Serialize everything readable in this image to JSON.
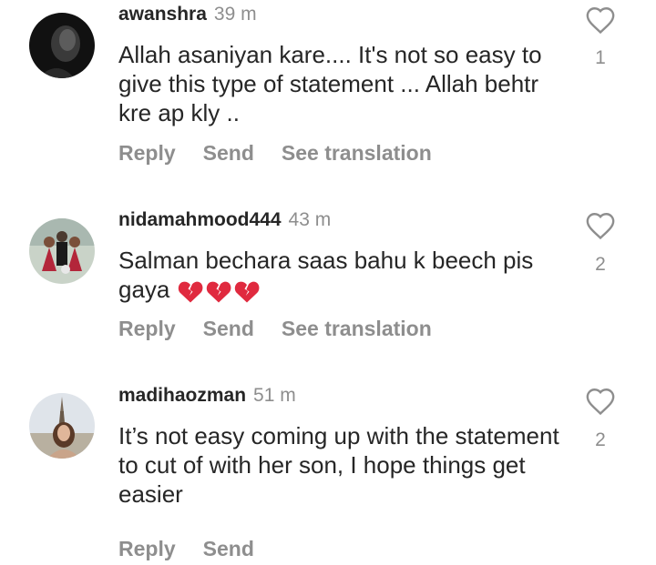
{
  "comments": [
    {
      "username": "awanshra",
      "time": "39 m",
      "text": "Allah asaniyan kare.... It's not so easy to give this type of statement ... Allah behtr kre ap kly ..",
      "likes": "1",
      "actions": {
        "reply": "Reply",
        "send": "Send",
        "translate": "See translation"
      }
    },
    {
      "username": "nidamahmood444",
      "time": "43 m",
      "text": "Salman bechara saas bahu k beech pis gaya",
      "emoji": [
        "broken-heart",
        "broken-heart",
        "broken-heart"
      ],
      "likes": "2",
      "actions": {
        "reply": "Reply",
        "send": "Send",
        "translate": "See translation"
      }
    },
    {
      "username": "madihaozman",
      "time": "51 m",
      "text": "It’s not easy coming up with the statement to cut of with her son, I hope things get easier",
      "likes": "2",
      "actions": {
        "reply": "Reply",
        "send": "Send"
      }
    }
  ],
  "colors": {
    "primary_text": "#262626",
    "secondary_text": "#8e8e8e",
    "emoji_red": "#e02a3f"
  }
}
